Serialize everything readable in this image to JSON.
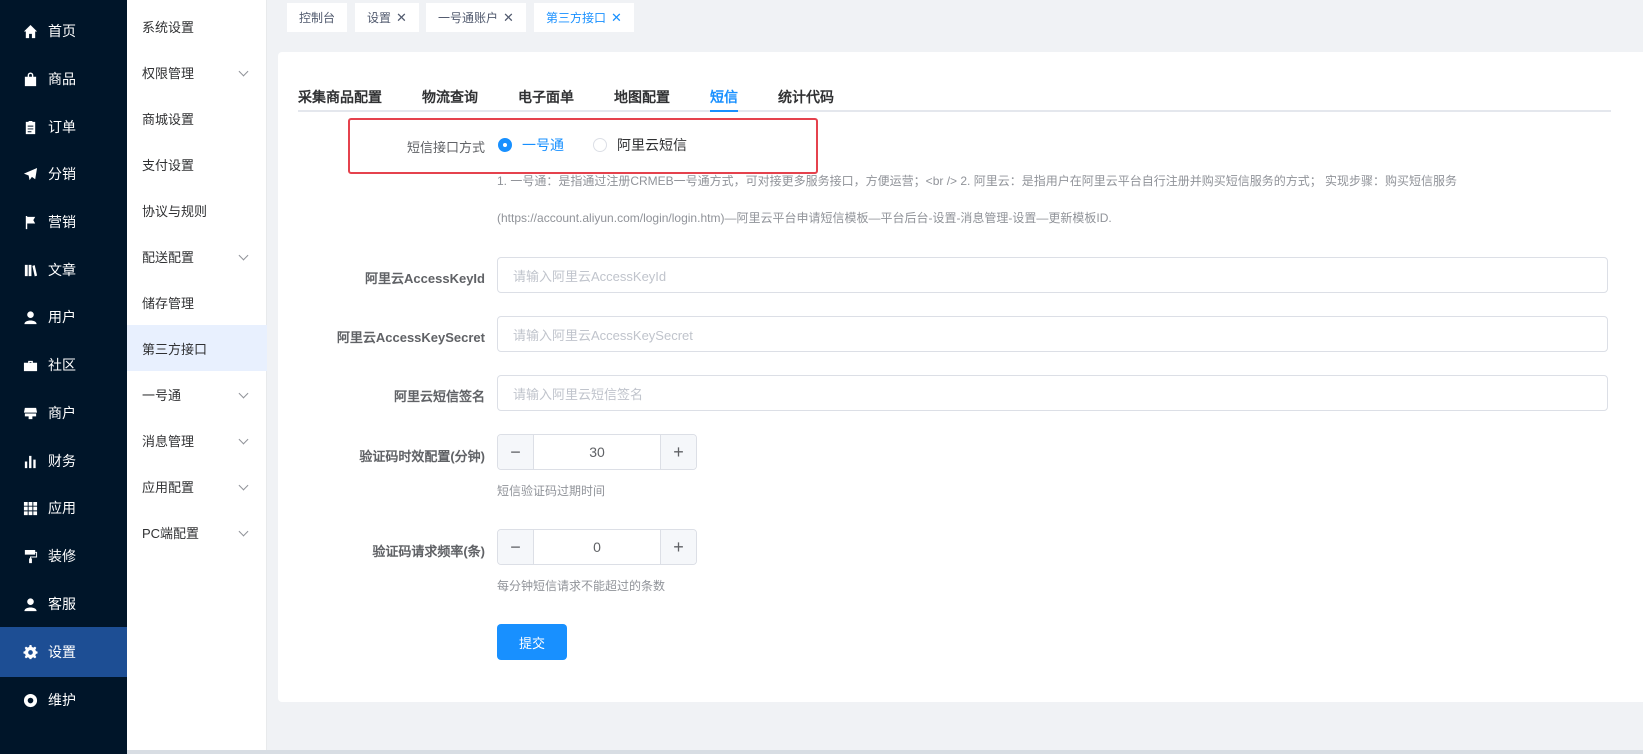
{
  "sidebar": {
    "items": [
      {
        "label": "首页",
        "icon": "home-icon"
      },
      {
        "label": "商品",
        "icon": "shopping-bag-icon"
      },
      {
        "label": "订单",
        "icon": "clipboard-icon"
      },
      {
        "label": "分销",
        "icon": "paper-plane-icon"
      },
      {
        "label": "营销",
        "icon": "flag-icon"
      },
      {
        "label": "文章",
        "icon": "book-icon"
      },
      {
        "label": "用户",
        "icon": "user-icon"
      },
      {
        "label": "社区",
        "icon": "briefcase-icon"
      },
      {
        "label": "商户",
        "icon": "store-icon"
      },
      {
        "label": "财务",
        "icon": "bar-chart-icon"
      },
      {
        "label": "应用",
        "icon": "grid-icon"
      },
      {
        "label": "装修",
        "icon": "paint-roller-icon"
      },
      {
        "label": "客服",
        "icon": "user-icon"
      },
      {
        "label": "设置",
        "icon": "gear-icon"
      },
      {
        "label": "维护",
        "icon": "lifebuoy-icon"
      }
    ],
    "active": "设置"
  },
  "submenu": {
    "items": [
      {
        "label": "系统设置",
        "expandable": false
      },
      {
        "label": "权限管理",
        "expandable": true
      },
      {
        "label": "商城设置",
        "expandable": false
      },
      {
        "label": "支付设置",
        "expandable": false
      },
      {
        "label": "协议与规则",
        "expandable": false
      },
      {
        "label": "配送配置",
        "expandable": true
      },
      {
        "label": "储存管理",
        "expandable": false
      },
      {
        "label": "第三方接口",
        "expandable": false
      },
      {
        "label": "一号通",
        "expandable": true
      },
      {
        "label": "消息管理",
        "expandable": true
      },
      {
        "label": "应用配置",
        "expandable": true
      },
      {
        "label": "PC端配置",
        "expandable": true
      }
    ],
    "active": "第三方接口"
  },
  "tags": [
    {
      "label": "控制台",
      "closable": false
    },
    {
      "label": "设置",
      "closable": true
    },
    {
      "label": "一号通账户",
      "closable": true
    },
    {
      "label": "第三方接口",
      "closable": true
    }
  ],
  "tabs": [
    "采集商品配置",
    "物流查询",
    "电子面单",
    "地图配置",
    "短信",
    "统计代码"
  ],
  "active_tab": "短信",
  "form": {
    "sms_method_label": "短信接口方式",
    "sms_options": [
      "一号通",
      "阿里云短信"
    ],
    "sms_selected": "一号通",
    "sms_help_line1": "1. 一号通：是指通过注册CRMEB一号通方式，可对接更多服务接口，方便运营；<br /> 2. 阿里云：是指用户在阿里云平台自行注册并购买短信服务的方式； 实现步骤：购买短信服务",
    "sms_help_line2": "(https://account.aliyun.com/login/login.htm)—阿里云平台申请短信模板—平台后台-设置-消息管理-设置—更新模板ID.",
    "access_key_id_label": "阿里云AccessKeyId",
    "access_key_id_placeholder": "请输入阿里云AccessKeyId",
    "access_key_secret_label": "阿里云AccessKeySecret",
    "access_key_secret_placeholder": "请输入阿里云AccessKeySecret",
    "sign_label": "阿里云短信签名",
    "sign_placeholder": "请输入阿里云短信签名",
    "code_expire_label": "验证码时效配置(分钟)",
    "code_expire_value": "30",
    "code_expire_help": "短信验证码过期时间",
    "code_rate_label": "验证码请求频率(条)",
    "code_rate_value": "0",
    "code_rate_help": "每分钟短信请求不能超过的条数",
    "submit_label": "提交"
  },
  "colors": {
    "sidebar_bg": "#001529",
    "active_nav": "#1d4e94",
    "primary": "#1890ff",
    "highlight_border": "#e5424d"
  }
}
